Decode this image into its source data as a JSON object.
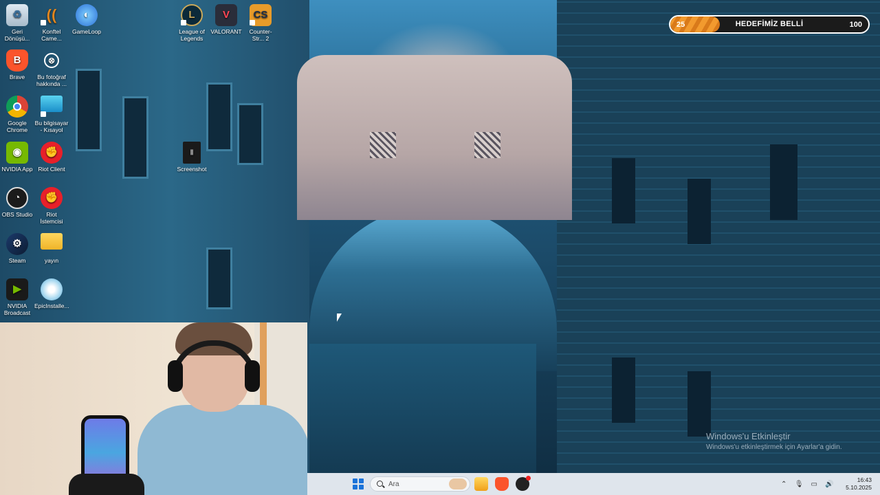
{
  "desktop_icons": [
    {
      "label": "Geri Dönüşü...",
      "icon": "recycle-bin-icon"
    },
    {
      "label": "Konftel Came...",
      "icon": "konftel-camera-icon"
    },
    {
      "label": "GameLoop",
      "icon": "gameloop-icon"
    },
    {
      "label": "League of Legends",
      "icon": "league-of-legends-icon"
    },
    {
      "label": "VALORANT",
      "icon": "valorant-icon"
    },
    {
      "label": "Counter-Str... 2",
      "icon": "counter-strike-icon"
    },
    {
      "label": "Brave",
      "icon": "brave-icon"
    },
    {
      "label": "Bu fotoğraf hakkında ...",
      "icon": "photo-info-icon"
    },
    {
      "label": "Google Chrome",
      "icon": "chrome-icon"
    },
    {
      "label": "Bu bilgisayar - Kısayol",
      "icon": "this-pc-icon"
    },
    {
      "label": "NVIDIA App",
      "icon": "nvidia-app-icon"
    },
    {
      "label": "Riot Client",
      "icon": "riot-client-icon"
    },
    {
      "label": "Screenshot",
      "icon": "screenshot-file-icon"
    },
    {
      "label": "OBS Studio",
      "icon": "obs-icon"
    },
    {
      "label": "Riot İstemcisi",
      "icon": "riot-istemcisi-icon"
    },
    {
      "label": "Steam",
      "icon": "steam-icon"
    },
    {
      "label": "yayın",
      "icon": "folder-icon"
    },
    {
      "label": "NVIDIA Broadcast",
      "icon": "nvidia-broadcast-icon"
    },
    {
      "label": "EpicInstalle...",
      "icon": "epic-installer-icon"
    }
  ],
  "goal_bar": {
    "start": "25",
    "title": "HEDEFİMİZ BELLİ",
    "end": "100",
    "progress_fraction": 0.25,
    "fill_color": "#f29a2e"
  },
  "watermark": {
    "title": "Windows'u Etkinleştir",
    "subtitle": "Windows'u etkinleştirmek için Ayarlar'a gidin."
  },
  "taskbar": {
    "search_placeholder": "Ara",
    "apps": [
      "file-explorer-icon",
      "brave-icon",
      "obs-icon"
    ],
    "tray_icons": [
      "chevron-up-icon",
      "microphone-icon",
      "network-icon",
      "volume-icon"
    ],
    "time": "16:43",
    "date": "5.10.2025"
  }
}
